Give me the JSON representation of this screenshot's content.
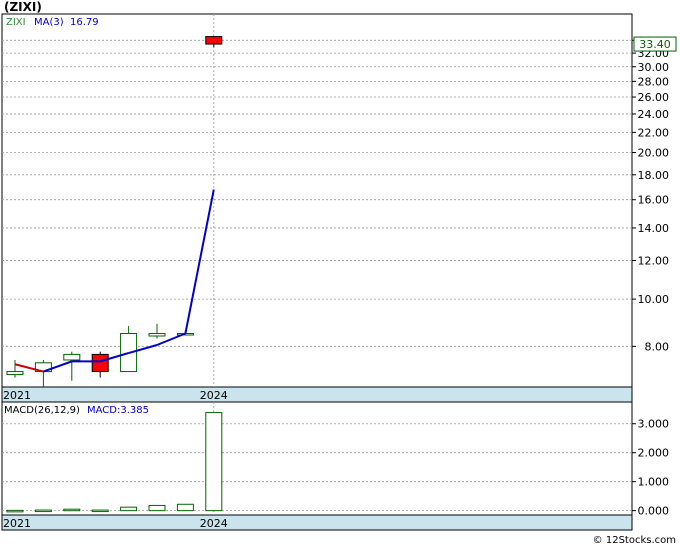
{
  "header": {
    "title": "(ZIXI)"
  },
  "legend": {
    "symbol": "ZIXI",
    "ma_label": "MA(3)",
    "ma_value": "16.79"
  },
  "macd_legend": {
    "params": "MACD(26,12,9)",
    "value": "MACD:3.385"
  },
  "last_price": {
    "label": "33.40",
    "value": 33.4
  },
  "watermark": "© 12Stocks.com",
  "colors": {
    "up": "#006400",
    "down_fill": "#ff0000",
    "ma": "#0000cc",
    "ma_start": "#cc0000",
    "axis_band": "#cbe3ec",
    "price_box": "#006400"
  },
  "chart_data": [
    {
      "type": "candlestick",
      "panel": "price",
      "scale": "log",
      "ylim": [
        6.6,
        38.5
      ],
      "yticks": [
        8,
        10,
        12,
        14,
        16,
        18,
        20,
        22,
        24,
        26,
        28,
        30,
        32,
        34
      ],
      "ytick_labels": [
        "8.00",
        "10.00",
        "12.00",
        "14.00",
        "16.00",
        "18.00",
        "20.00",
        "22.00",
        "24.00",
        "26.00",
        "28.00",
        "30.00",
        "32.00",
        "34.00"
      ],
      "x_labels": [
        {
          "index": 0,
          "label": "2021"
        },
        {
          "index": 7,
          "label": "2024"
        }
      ],
      "bars": [
        {
          "o": 7.0,
          "h": 7.5,
          "l": 6.9,
          "c": 7.1,
          "dir": "up"
        },
        {
          "o": 7.1,
          "h": 7.5,
          "l": 6.6,
          "c": 7.4,
          "dir": "up"
        },
        {
          "o": 7.5,
          "h": 7.8,
          "l": 6.8,
          "c": 7.7,
          "dir": "up"
        },
        {
          "o": 7.7,
          "h": 7.8,
          "l": 6.9,
          "c": 7.1,
          "dir": "down"
        },
        {
          "o": 7.1,
          "h": 8.8,
          "l": 7.1,
          "c": 8.5,
          "dir": "up"
        },
        {
          "o": 8.4,
          "h": 8.9,
          "l": 8.3,
          "c": 8.5,
          "dir": "up"
        },
        {
          "o": 8.5,
          "h": 8.6,
          "l": 8.5,
          "c": 8.5,
          "dir": "up"
        },
        {
          "o": 34.6,
          "h": 34.6,
          "l": 32.9,
          "c": 33.4,
          "dir": "down"
        }
      ],
      "ma": {
        "name": "MA(3)",
        "values": [
          7.35,
          7.1,
          7.45,
          7.45,
          7.75,
          8.05,
          8.5,
          16.79
        ]
      }
    },
    {
      "type": "bar",
      "panel": "macd",
      "ylim": [
        -0.15,
        3.75
      ],
      "yticks": [
        0,
        1,
        2,
        3
      ],
      "ytick_labels": [
        "0.000",
        "1.000",
        "2.000",
        "3.000"
      ],
      "x_labels": [
        {
          "index": 0,
          "label": "2021"
        },
        {
          "index": 7,
          "label": "2024"
        }
      ],
      "values": [
        0.01,
        0.02,
        0.05,
        0.02,
        0.12,
        0.18,
        0.22,
        3.385
      ]
    }
  ]
}
